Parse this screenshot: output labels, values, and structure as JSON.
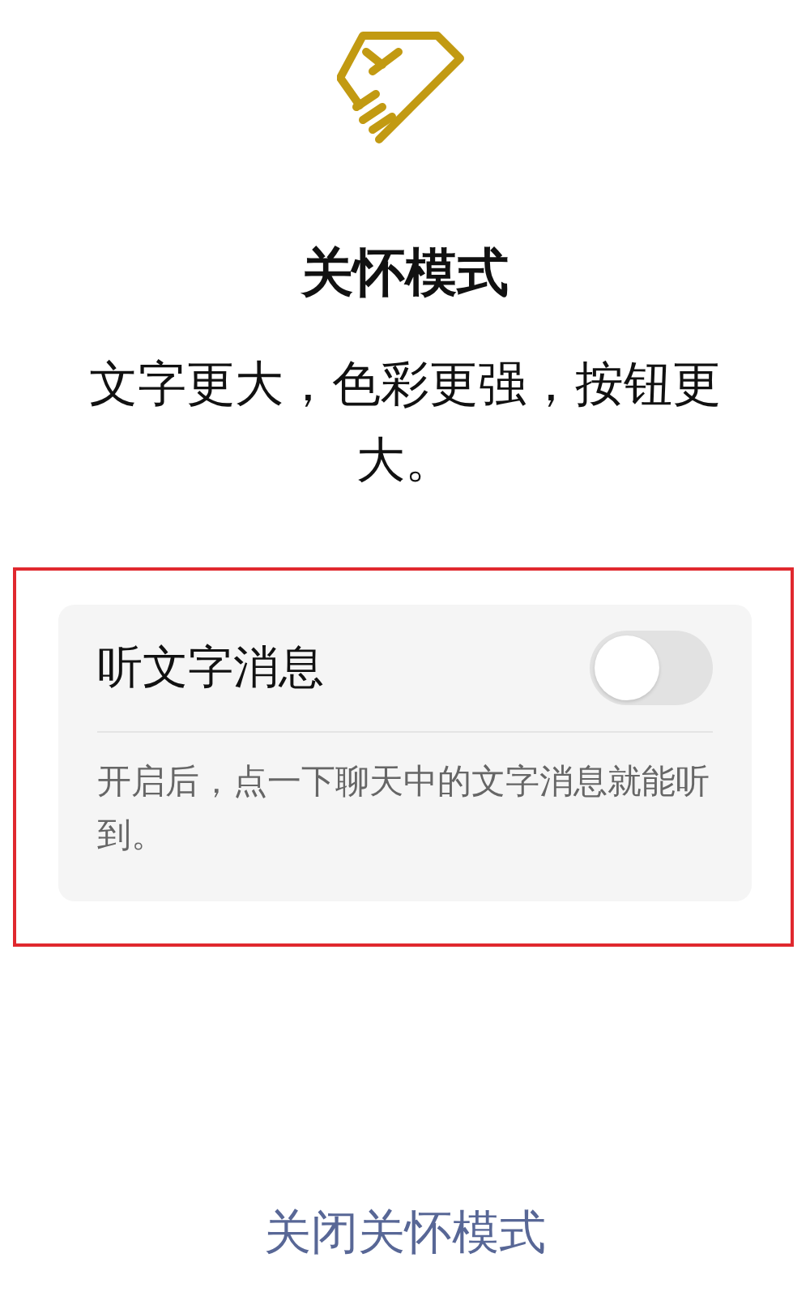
{
  "title": "关怀模式",
  "subtitle": "文字更大，色彩更强，按钮更大。",
  "highlighted": true,
  "setting": {
    "label": "听文字消息",
    "on": false,
    "description": "开启后，点一下聊天中的文字消息就能听到。"
  },
  "footer_link": "关闭关怀模式"
}
